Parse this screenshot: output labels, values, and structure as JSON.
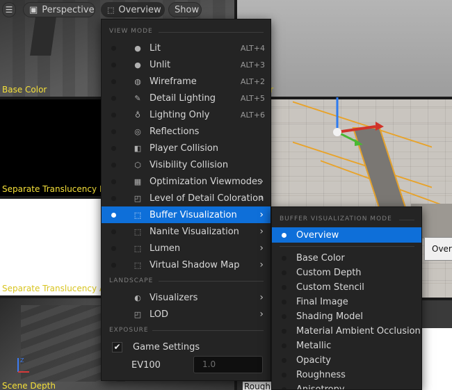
{
  "toolbar": {
    "perspective_label": "Perspective",
    "overview_label": "Overview",
    "show_label": "Show"
  },
  "viewports": {
    "top_left_label": "Base Color",
    "top_right_label_fragment": "ar",
    "mid_left_label": "Separate Translucency R",
    "lower_left_label": "Separate Translucency A",
    "bottom_left_label": "Scene Depth",
    "bottom_right_label_fragment": "Roughn"
  },
  "view_menu": {
    "section_view_mode": "VIEW MODE",
    "items": [
      {
        "label": "Lit",
        "shortcut": "ALT+4",
        "icon": "lit-sphere-icon"
      },
      {
        "label": "Unlit",
        "shortcut": "ALT+3",
        "icon": "unlit-sphere-icon"
      },
      {
        "label": "Wireframe",
        "shortcut": "ALT+2",
        "icon": "wireframe-icon"
      },
      {
        "label": "Detail Lighting",
        "shortcut": "ALT+5",
        "icon": "detail-lighting-icon"
      },
      {
        "label": "Lighting Only",
        "shortcut": "ALT+6",
        "icon": "bulb-icon"
      },
      {
        "label": "Reflections",
        "shortcut": "",
        "icon": "reflections-icon"
      },
      {
        "label": "Player Collision",
        "shortcut": "",
        "icon": "player-collision-icon"
      },
      {
        "label": "Visibility Collision",
        "shortcut": "",
        "icon": "visibility-collision-icon"
      },
      {
        "label": "Optimization Viewmodes",
        "shortcut": "",
        "icon": "optimization-icon",
        "submenu": true
      },
      {
        "label": "Level of Detail Coloration",
        "shortcut": "",
        "icon": "lod-coloration-icon",
        "submenu": true
      },
      {
        "label": "Buffer Visualization",
        "shortcut": "",
        "icon": "buffer-icon",
        "submenu": true,
        "active": true
      },
      {
        "label": "Nanite Visualization",
        "shortcut": "",
        "icon": "nanite-icon",
        "submenu": true
      },
      {
        "label": "Lumen",
        "shortcut": "",
        "icon": "lumen-icon",
        "submenu": true
      },
      {
        "label": "Virtual Shadow Map",
        "shortcut": "",
        "icon": "shadow-map-icon",
        "submenu": true
      }
    ],
    "section_landscape": "LANDSCAPE",
    "landscape_items": [
      {
        "label": "Visualizers",
        "icon": "visualizers-icon"
      },
      {
        "label": "LOD",
        "icon": "lod-icon"
      }
    ],
    "section_exposure": "EXPOSURE",
    "game_settings_label": "Game Settings",
    "game_settings_checked": true,
    "ev100_label": "EV100",
    "ev100_value": "1.0"
  },
  "buffer_menu": {
    "section_header": "BUFFER VISUALIZATION MODE",
    "overview_label": "Overview",
    "items": [
      "Base Color",
      "Custom Depth",
      "Custom Stencil",
      "Final Image",
      "Shading Model",
      "Material Ambient Occlusion",
      "Metallic",
      "Opacity",
      "Roughness",
      "Anisotropy"
    ]
  },
  "tooltip": {
    "text": "Overv"
  },
  "colors": {
    "accent_blue": "#0e6fd9",
    "label_yellow": "#f5e03a",
    "menu_bg": "#242424",
    "outline_orange": "#e8a32a"
  }
}
